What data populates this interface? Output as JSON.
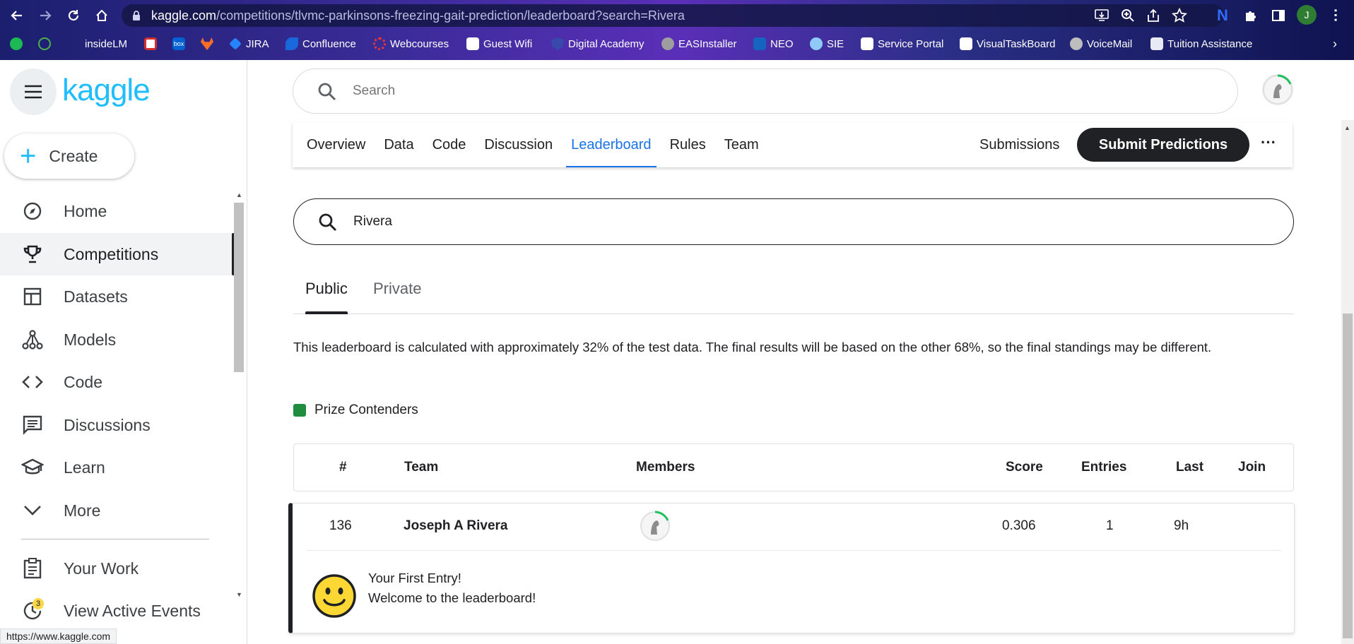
{
  "browser": {
    "url_host": "kaggle.com",
    "url_path": "/competitions/tlvmc-parkinsons-freezing-gait-prediction/leaderboard?search=Rivera",
    "profile_initial": "J",
    "bookmarks": [
      "insideLM",
      "JIRA",
      "Confluence",
      "Webcourses",
      "Guest Wifi",
      "Digital Academy",
      "EASInstaller",
      "NEO",
      "SIE",
      "Service Portal",
      "VisualTaskBoard",
      "VoiceMail",
      "Tuition Assistance"
    ],
    "status_url": "https://www.kaggle.com"
  },
  "sidebar": {
    "logo": "kaggle",
    "create_label": "Create",
    "items": [
      {
        "label": "Home",
        "icon": "compass-icon"
      },
      {
        "label": "Competitions",
        "icon": "trophy-icon"
      },
      {
        "label": "Datasets",
        "icon": "table-icon"
      },
      {
        "label": "Models",
        "icon": "models-icon"
      },
      {
        "label": "Code",
        "icon": "code-icon"
      },
      {
        "label": "Discussions",
        "icon": "comment-icon"
      },
      {
        "label": "Learn",
        "icon": "school-icon"
      },
      {
        "label": "More",
        "icon": "chevron-down-icon"
      }
    ],
    "your_work": "Your Work",
    "view_active_events": "View Active Events",
    "events_count": "3",
    "active_item": "Competitions"
  },
  "header": {
    "search_placeholder": "Search"
  },
  "competition_nav": {
    "tabs": [
      "Overview",
      "Data",
      "Code",
      "Discussion",
      "Leaderboard",
      "Rules",
      "Team"
    ],
    "active_tab": "Leaderboard",
    "submissions_label": "Submissions",
    "submit_label": "Submit Predictions",
    "more_label": "···"
  },
  "leaderboard": {
    "search_value": "Rivera",
    "tabs": [
      "Public",
      "Private"
    ],
    "active_tab": "Public",
    "note": "This leaderboard is calculated with approximately 32% of the test data. The final results will be based on the other 68%, so the final standings may be different.",
    "legend_label": "Prize Contenders",
    "legend_color": "#1e8e3e",
    "columns": [
      "#",
      "Team",
      "Members",
      "Score",
      "Entries",
      "Last",
      "Join"
    ],
    "row": {
      "rank": "136",
      "team": "Joseph A Rivera",
      "score": "0.306",
      "entries": "1",
      "last": "9h",
      "join": ""
    },
    "entry_message_line1": "Your First Entry!",
    "entry_message_line2": "Welcome to the leaderboard!"
  },
  "colors": {
    "accent": "#20beff",
    "link": "#1a73e8",
    "dark": "#202124"
  }
}
